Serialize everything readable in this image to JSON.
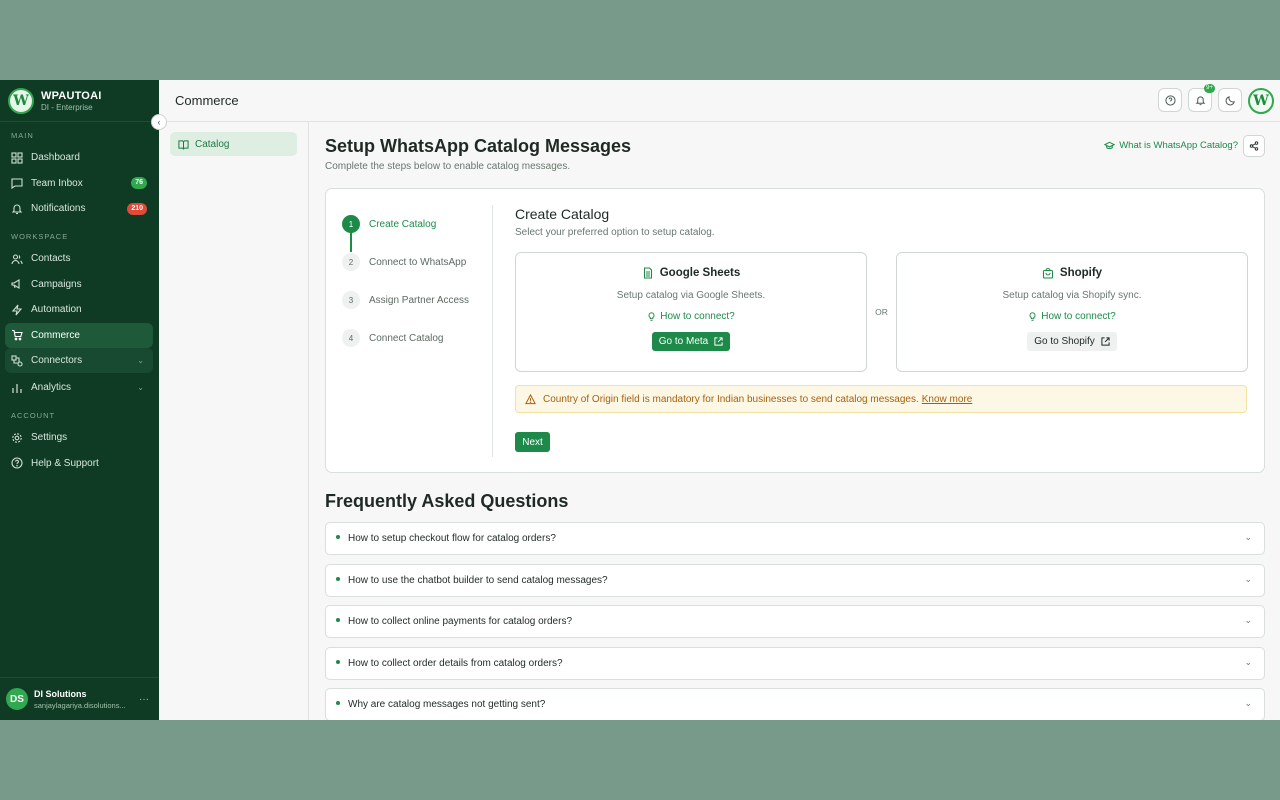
{
  "brand": {
    "name": "WPAUTOAI",
    "sub": "DI - Enterprise",
    "logo_letter": "W"
  },
  "sidebar": {
    "sections": {
      "main": "MAIN",
      "workspace": "WORKSPACE",
      "account": "ACCOUNT"
    },
    "items": [
      {
        "label": "Dashboard"
      },
      {
        "label": "Team Inbox",
        "badge": "76"
      },
      {
        "label": "Notifications",
        "badge": "210"
      },
      {
        "label": "Contacts"
      },
      {
        "label": "Campaigns"
      },
      {
        "label": "Automation"
      },
      {
        "label": "Commerce"
      },
      {
        "label": "Connectors"
      },
      {
        "label": "Analytics"
      },
      {
        "label": "Settings"
      },
      {
        "label": "Help & Support"
      }
    ],
    "collapse_glyph": "‹",
    "chevron_glyph": "⌄"
  },
  "user": {
    "initials": "DS",
    "name": "DI Solutions",
    "email": "sanjaylagariya.disolutions...",
    "more": "···"
  },
  "topbar": {
    "title": "Commerce",
    "notif_badge": "9+"
  },
  "subnav": {
    "catalog": "Catalog"
  },
  "page": {
    "title": "Setup WhatsApp Catalog Messages",
    "subtitle": "Complete the steps below to enable catalog messages.",
    "help_link": "What is WhatsApp Catalog?"
  },
  "steps": [
    {
      "num": "1",
      "label": "Create Catalog"
    },
    {
      "num": "2",
      "label": "Connect to WhatsApp"
    },
    {
      "num": "3",
      "label": "Assign Partner Access"
    },
    {
      "num": "4",
      "label": "Connect Catalog"
    }
  ],
  "create": {
    "title": "Create Catalog",
    "subtitle": "Select your preferred option to setup catalog.",
    "or": "OR",
    "google": {
      "title": "Google Sheets",
      "desc": "Setup catalog via Google Sheets.",
      "link": "How to connect?",
      "button": "Go to Meta"
    },
    "shopify": {
      "title": "Shopify",
      "desc": "Setup catalog via Shopify sync.",
      "link": "How to connect?",
      "button": "Go to Shopify"
    },
    "warning": "Country of Origin field is mandatory for Indian businesses to send catalog messages.",
    "warning_link": "Know more",
    "next": "Next"
  },
  "faq": {
    "title": "Frequently Asked Questions",
    "chevron": "⌄",
    "items": [
      "How to setup checkout flow for catalog orders?",
      "How to use the chatbot builder to send catalog messages?",
      "How to collect online payments for catalog orders?",
      "How to collect order details from catalog orders?",
      "Why are catalog messages not getting sent?"
    ]
  },
  "colors": {
    "accent": "#1e8a4a",
    "sidebar_bg": "#0f3b24",
    "backdrop": "#779a8a"
  },
  "icons": [
    "dashboard-icon",
    "inbox-icon",
    "bell-icon",
    "contacts-icon",
    "megaphone-icon",
    "automation-icon",
    "cart-icon",
    "connectors-icon",
    "chart-icon",
    "gear-icon",
    "help-icon",
    "book-icon",
    "share-icon",
    "document-icon",
    "shopify-bag-icon",
    "bulb-icon",
    "external-link-icon",
    "warning-icon",
    "moon-icon"
  ]
}
